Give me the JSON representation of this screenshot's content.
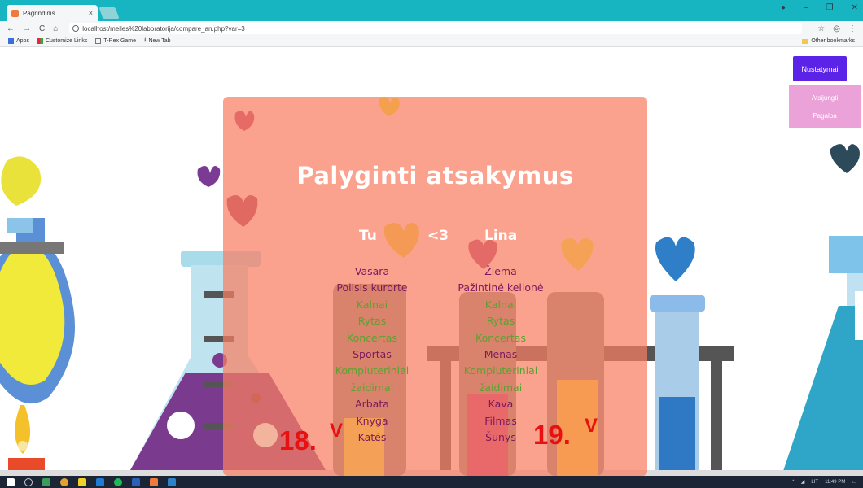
{
  "browser": {
    "tab_title": "Pagrindinis",
    "tab_close": "×",
    "url": "localhost/meiles%20laboratorija/compare_an.php?var=3",
    "bookmarks": [
      "Apps",
      "Customize Links",
      "T-Rex Game",
      "New Tab"
    ],
    "other_bookmarks": "Other bookmarks"
  },
  "nav": {
    "settings_label": "Nustatymai",
    "logout_label": "Atsijungti",
    "help_label": "Pagalba"
  },
  "compare": {
    "title": "Palyginti atsakymus",
    "left_name": "Tu",
    "connector": "<3",
    "right_name": "Lina",
    "left_answers": [
      {
        "text": "Vasara",
        "match": false
      },
      {
        "text": "Poilsis kurorte",
        "match": false
      },
      {
        "text": "Kalnai",
        "match": true
      },
      {
        "text": "Rytas",
        "match": true
      },
      {
        "text": "Koncertas",
        "match": true
      },
      {
        "text": "Sportas",
        "match": false
      },
      {
        "text": "Kompiuteriniai",
        "match": true
      },
      {
        "text": "žaidimai",
        "match": true
      },
      {
        "text": "Arbata",
        "match": false
      },
      {
        "text": "Knyga",
        "match": false
      },
      {
        "text": "Katės",
        "match": false
      }
    ],
    "right_answers": [
      {
        "text": "Žiema",
        "match": false
      },
      {
        "text": "Pažintinė kelionė",
        "match": false
      },
      {
        "text": "Kalnai",
        "match": true
      },
      {
        "text": "Rytas",
        "match": true
      },
      {
        "text": "Koncertas",
        "match": true
      },
      {
        "text": "Menas",
        "match": false
      },
      {
        "text": "Kompiuteriniai",
        "match": true
      },
      {
        "text": "žaidimai",
        "match": true
      },
      {
        "text": "Kava",
        "match": false
      },
      {
        "text": "Filmas",
        "match": false
      },
      {
        "text": "Šunys",
        "match": false
      }
    ]
  },
  "annotations": {
    "left_number": "18.",
    "left_mark": "V",
    "right_number": "19.",
    "right_mark": "V"
  },
  "taskbar": {
    "time": "11:49 PM",
    "lang": "LIT"
  },
  "colors": {
    "tabbar": "#17b5c1",
    "card": "#f97e62",
    "match_green": "#5aa22f",
    "mismatch_purple": "#7b1a5c",
    "settings_button": "#5b22e8",
    "menu_box": "#eaa2d8",
    "annotation_red": "#e81010"
  }
}
